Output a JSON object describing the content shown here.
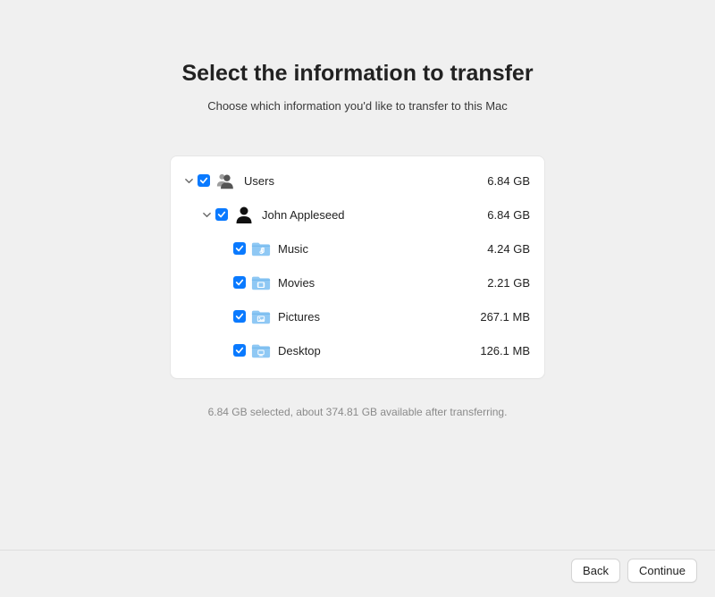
{
  "title": "Select the information to transfer",
  "subtitle": "Choose which information you'd like to transfer to this Mac",
  "tree": {
    "users": {
      "label": "Users",
      "size": "6.84 GB"
    },
    "user0": {
      "label": "John Appleseed",
      "size": "6.84 GB"
    },
    "items": [
      {
        "label": "Music",
        "size": "4.24 GB"
      },
      {
        "label": "Movies",
        "size": "2.21 GB"
      },
      {
        "label": "Pictures",
        "size": "267.1 MB"
      },
      {
        "label": "Desktop",
        "size": "126.1 MB"
      }
    ]
  },
  "status": "6.84 GB selected, about 374.81 GB available after transferring.",
  "buttons": {
    "back": "Back",
    "continue": "Continue"
  }
}
